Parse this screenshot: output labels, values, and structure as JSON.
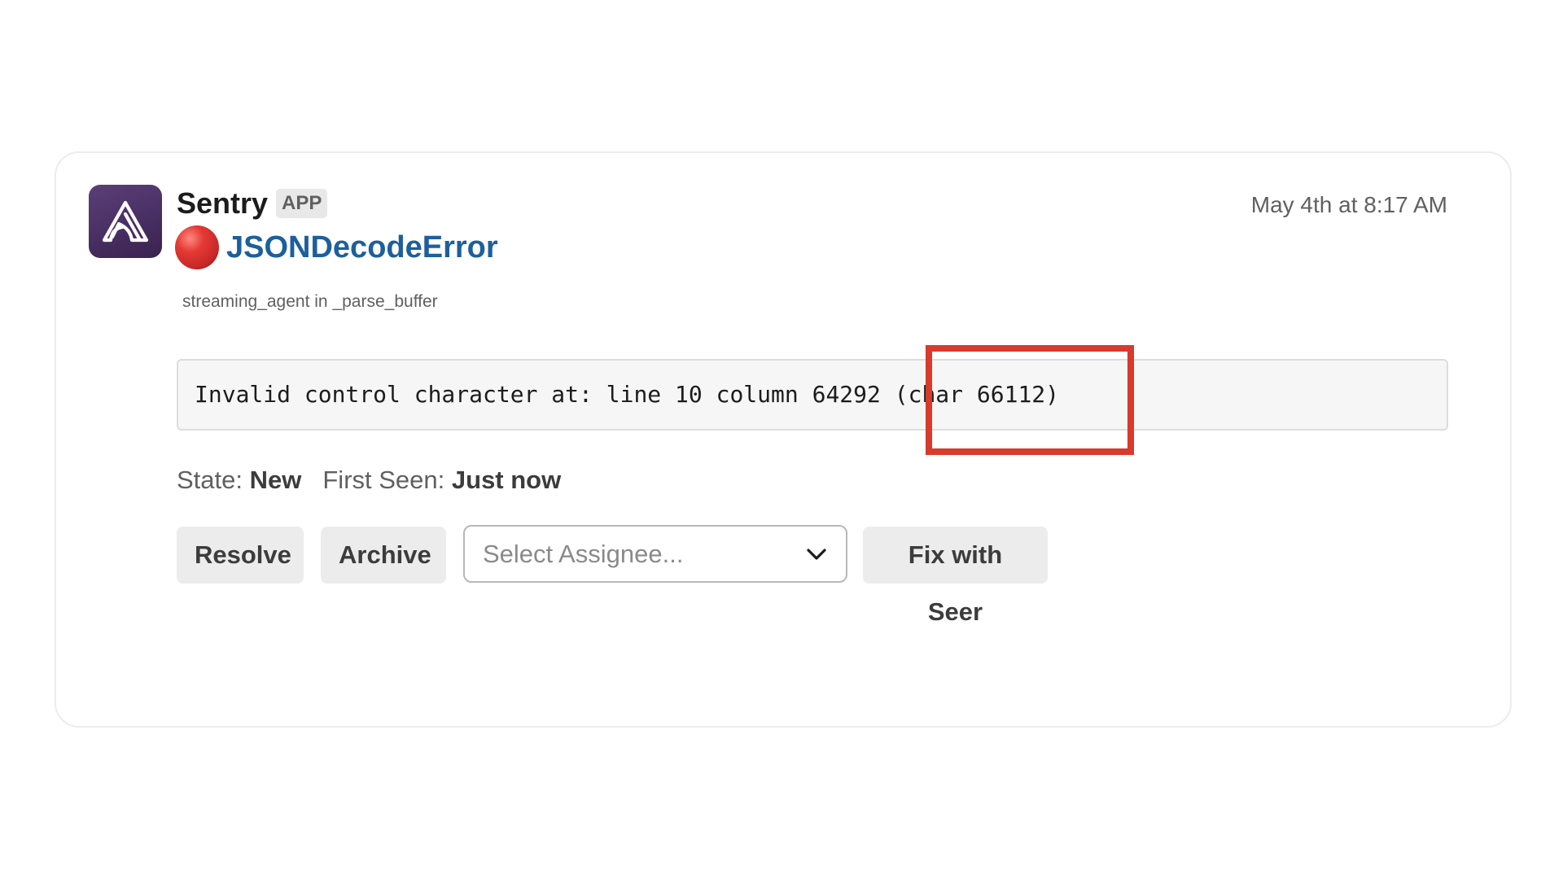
{
  "message": {
    "app_name": "Sentry",
    "app_badge": "APP",
    "timestamp": "May 4th at 8:17 AM",
    "icons": {
      "app_icon": "sentry-logo-icon",
      "status": "red-circle-icon",
      "dropdown": "chevron-down-icon"
    },
    "error_title": "JSONDecodeError",
    "culprit": "streaming_agent in _parse_buffer",
    "error_message": "Invalid control character at: line 10 column 64292 (char 66112)",
    "meta": {
      "state_label": "State:",
      "state_value": "New",
      "first_seen_label": "First Seen:",
      "first_seen_value": "Just now"
    },
    "actions": {
      "resolve_label": "Resolve",
      "archive_label": "Archive",
      "assignee_placeholder": "Select Assignee...",
      "fix_label": "Fix with Seer"
    },
    "colors": {
      "status_dot": "#e53935",
      "error_link": "#1d5f9c",
      "highlight": "#d93a2b",
      "app_icon_bg": "#4a2f63"
    }
  }
}
